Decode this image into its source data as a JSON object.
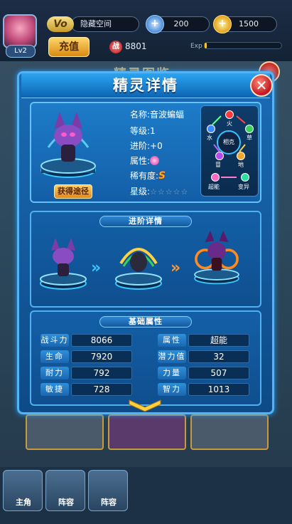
{
  "hud": {
    "level": "Lv2",
    "vip": "Vo",
    "player_name": "隐藏空间",
    "gems": "200",
    "coins": "1500",
    "recharge": "充值",
    "war_icon": "战",
    "war_points": "8801",
    "exp_label": "Exp",
    "exp_fraction": 0.03
  },
  "background": {
    "title": "精灵图鉴"
  },
  "panel": {
    "title": "精灵详情",
    "close_glyph": "✕"
  },
  "info": {
    "name_label": "名称:",
    "name": "音波蝙蝠",
    "level_label": "等级:",
    "level": "1",
    "advance_label": "进阶:",
    "advance": "+0",
    "attr_label": "属性:",
    "rarity_label": "稀有度:",
    "rarity": "S",
    "star_label": "星级:",
    "stars": "☆☆☆☆☆",
    "get_button": "获得途径"
  },
  "types": {
    "center": "相克",
    "fire": "火",
    "water": "水",
    "grass": "草",
    "ghost": "冒",
    "earth": "地",
    "psychic": "超能",
    "mutant": "变异"
  },
  "evolution": {
    "header": "进阶详情"
  },
  "stats": {
    "header": "基础属性",
    "left": [
      {
        "label": "战斗力",
        "value": "8066"
      },
      {
        "label": "生命",
        "value": "7920"
      },
      {
        "label": "耐力",
        "value": "792"
      },
      {
        "label": "敏捷",
        "value": "728"
      }
    ],
    "right": [
      {
        "label": "属性",
        "value": "超能"
      },
      {
        "label": "潜力值",
        "value": "32"
      },
      {
        "label": "力量",
        "value": "507"
      },
      {
        "label": "智力",
        "value": "1013"
      }
    ]
  },
  "bottom_nav": [
    {
      "label": "主角"
    },
    {
      "label": "阵容"
    },
    {
      "label": "阵容"
    }
  ],
  "colors": {
    "accent": "#53b3f5",
    "gold": "#ffb000",
    "close": "#c2141d"
  }
}
